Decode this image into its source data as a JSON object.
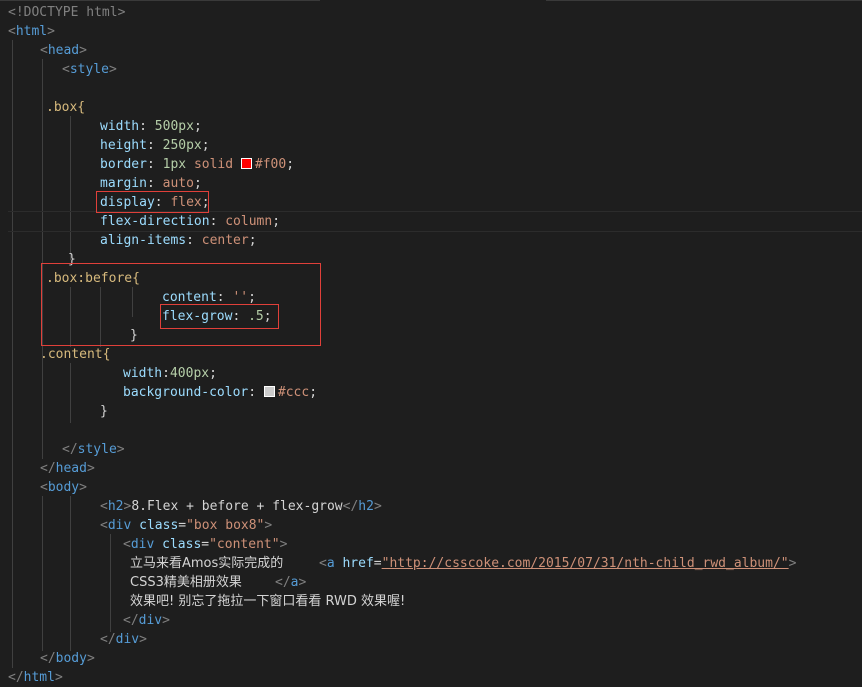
{
  "editor": {
    "lines": {
      "l1": "<!DOCTYPE html>",
      "l2_tag": "html",
      "l3_tag": "head",
      "l4_tag": "style",
      "l6_sel": ".box{",
      "l7_prop": "width",
      "l7_val": "500px",
      "l8_prop": "height",
      "l8_val": "250px",
      "l9_prop": "border",
      "l9_a": "1px",
      "l9_b": "solid",
      "l9_c": "#f00",
      "l10_prop": "margin",
      "l10_val": "auto",
      "l11_prop": "display",
      "l11_val": "flex",
      "l12_prop": "flex-direction",
      "l12_val": "column",
      "l13_prop": "align-items",
      "l13_val": "center",
      "l14": "}",
      "l15_sel": ".box:before{",
      "l16_prop": "content",
      "l16_val": "''",
      "l17_prop": "flex-grow",
      "l17_val": ".5",
      "l18": "}",
      "l19_sel": ".content{",
      "l20_prop": "width",
      "l20_val": "400px",
      "l21_prop": "background-color",
      "l21_val": "#ccc",
      "l22": "}",
      "l24_tag": "style",
      "l25_tag": "head",
      "l26_tag": "body",
      "l27_tag": "h2",
      "l27_text": "8.Flex + before + flex-grow",
      "l28_tag": "div",
      "l28_attr": "class",
      "l28_val": "\"box box8\"",
      "l29_tag": "div",
      "l29_attr": "class",
      "l29_val": "\"content\"",
      "l30_text": "立马来看Amos实际完成的",
      "l30_tag": "a",
      "l30_attr": "href",
      "l30_val": "\"http://csscoke.com/2015/07/31/nth-child_rwd_album/\"",
      "l31_text": "CSS3精美相册效果",
      "l31_tag": "a",
      "l32_text": "效果吧! 别忘了拖拉一下窗口看看 RWD 效果喔!",
      "l33_tag": "div",
      "l34_tag": "div",
      "l35_tag": "body",
      "l36_tag": "html"
    },
    "swatch_colors": {
      "red": "#ff0000",
      "gray": "#cccccc"
    },
    "highlight_color": "#e0403a"
  }
}
